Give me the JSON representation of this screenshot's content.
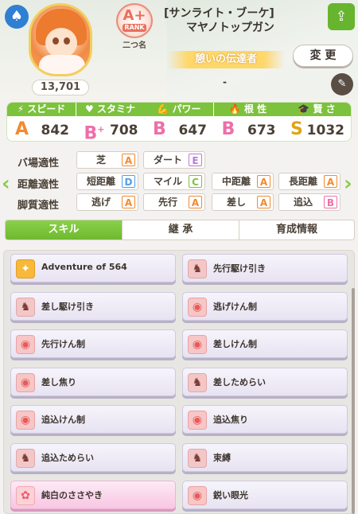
{
  "header": {
    "club_icon": "spade-icon",
    "fans": "13,701",
    "rank_grade": "A+",
    "rank_text": "RANK",
    "rank_label": "二つ名",
    "title_line1": "[サンライト・ブーケ]",
    "title_line2": "マヤノトップガン",
    "epithet": "憩いの伝達者",
    "change_label": "変 更",
    "dash": "-",
    "share_icon": "share-icon",
    "edit_icon": "pencil-icon"
  },
  "stats": [
    {
      "label": "スピード",
      "icon": "shoe-icon",
      "grade": "A",
      "grade_color": "#f28a2d",
      "value": "842"
    },
    {
      "label": "スタミナ",
      "icon": "heart-icon",
      "grade": "B",
      "grade_sup": "+",
      "grade_color": "#ee6fa8",
      "value": "708"
    },
    {
      "label": "パワー",
      "icon": "muscle-icon",
      "grade": "B",
      "grade_color": "#ee6fa8",
      "value": "647"
    },
    {
      "label": "根 性",
      "icon": "flame-icon",
      "grade": "B",
      "grade_color": "#ee6fa8",
      "value": "673"
    },
    {
      "label": "賢 さ",
      "icon": "mortarboard-icon",
      "grade": "S",
      "grade_color": "#e0a416",
      "value": "1032"
    }
  ],
  "aptitude": {
    "track_label": "バ場適性",
    "track": [
      {
        "name": "芝",
        "grade": "A"
      },
      {
        "name": "ダート",
        "grade": "E"
      }
    ],
    "distance_label": "距離適性",
    "distance": [
      {
        "name": "短距離",
        "grade": "D"
      },
      {
        "name": "マイル",
        "grade": "C"
      },
      {
        "name": "中距離",
        "grade": "A"
      },
      {
        "name": "長距離",
        "grade": "A"
      }
    ],
    "style_label": "脚質適性",
    "style": [
      {
        "name": "逃げ",
        "grade": "A"
      },
      {
        "name": "先行",
        "grade": "A"
      },
      {
        "name": "差し",
        "grade": "A"
      },
      {
        "name": "追込",
        "grade": "B"
      }
    ]
  },
  "grade_colors": {
    "A": "#f28a2d",
    "B": "#ee6fa8",
    "C": "#7cc23d",
    "D": "#4f9ee6",
    "E": "#b77ad9"
  },
  "tabs": [
    {
      "label": "スキル",
      "active": true
    },
    {
      "label": "継 承",
      "active": false
    },
    {
      "label": "育成情報",
      "active": false
    }
  ],
  "skills": [
    {
      "name": "Adventure of 564",
      "icon": "gold",
      "style": "normal"
    },
    {
      "name": "先行駆け引き",
      "icon": "brown",
      "style": "normal"
    },
    {
      "name": "差し駆け引き",
      "icon": "brown",
      "style": "normal"
    },
    {
      "name": "逃げけん制",
      "icon": "red",
      "style": "normal"
    },
    {
      "name": "先行けん制",
      "icon": "red",
      "style": "normal"
    },
    {
      "name": "差しけん制",
      "icon": "red",
      "style": "normal"
    },
    {
      "name": "差し焦り",
      "icon": "red",
      "style": "normal"
    },
    {
      "name": "差しためらい",
      "icon": "brown",
      "style": "normal"
    },
    {
      "name": "追込けん制",
      "icon": "red",
      "style": "normal"
    },
    {
      "name": "追込焦り",
      "icon": "red",
      "style": "normal"
    },
    {
      "name": "追込ためらい",
      "icon": "brown",
      "style": "normal"
    },
    {
      "name": "束縛",
      "icon": "brown",
      "style": "normal"
    },
    {
      "name": "純白のささやき",
      "icon": "pink",
      "style": "pink"
    },
    {
      "name": "鋭い眼光",
      "icon": "red",
      "style": "normal"
    }
  ]
}
